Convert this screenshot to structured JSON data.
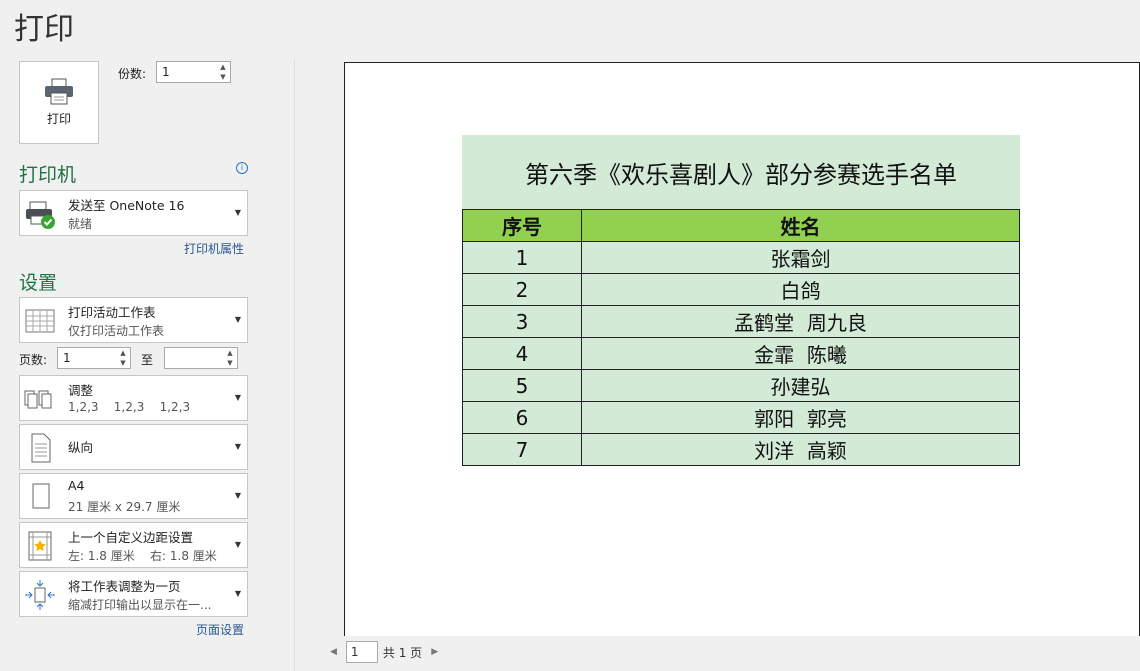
{
  "header": {
    "title": "打印"
  },
  "print_button": {
    "label": "打印"
  },
  "copies": {
    "label": "份数:",
    "value": "1"
  },
  "printer": {
    "heading": "打印机",
    "name": "发送至 OneNote 16",
    "status": "就绪",
    "properties_link": "打印机属性"
  },
  "settings": {
    "heading": "设置",
    "scope": {
      "title": "打印活动工作表",
      "subtitle": "仅打印活动工作表"
    },
    "pages": {
      "label": "页数:",
      "from": "1",
      "to_label": "至",
      "to": ""
    },
    "collate": {
      "title": "调整",
      "subtitle": "1,2,3    1,2,3    1,2,3"
    },
    "orientation": {
      "title": "纵向"
    },
    "paper": {
      "title": "A4",
      "subtitle": "21 厘米 x 29.7 厘米"
    },
    "margins": {
      "title": "上一个自定义边距设置",
      "subtitle": "左: 1.8 厘米    右: 1.8 厘米"
    },
    "scaling": {
      "title": "将工作表调整为一页",
      "subtitle": "缩减打印输出以显示在一..."
    },
    "page_setup_link": "页面设置"
  },
  "preview": {
    "sheet_title": "第六季《欢乐喜剧人》部分参赛选手名单",
    "columns": [
      "序号",
      "姓名"
    ],
    "rows": [
      [
        "1",
        "张霜剑"
      ],
      [
        "2",
        "白鸽"
      ],
      [
        "3",
        "孟鹤堂  周九良"
      ],
      [
        "4",
        "金霏  陈曦"
      ],
      [
        "5",
        "孙建弘"
      ],
      [
        "6",
        "郭阳  郭亮"
      ],
      [
        "7",
        "刘洋  高颖"
      ]
    ],
    "colors": {
      "header_bg": "#92d050",
      "cell_bg": "#d2ead6"
    }
  },
  "pager": {
    "current": "1",
    "total_label": "共 1 页"
  }
}
